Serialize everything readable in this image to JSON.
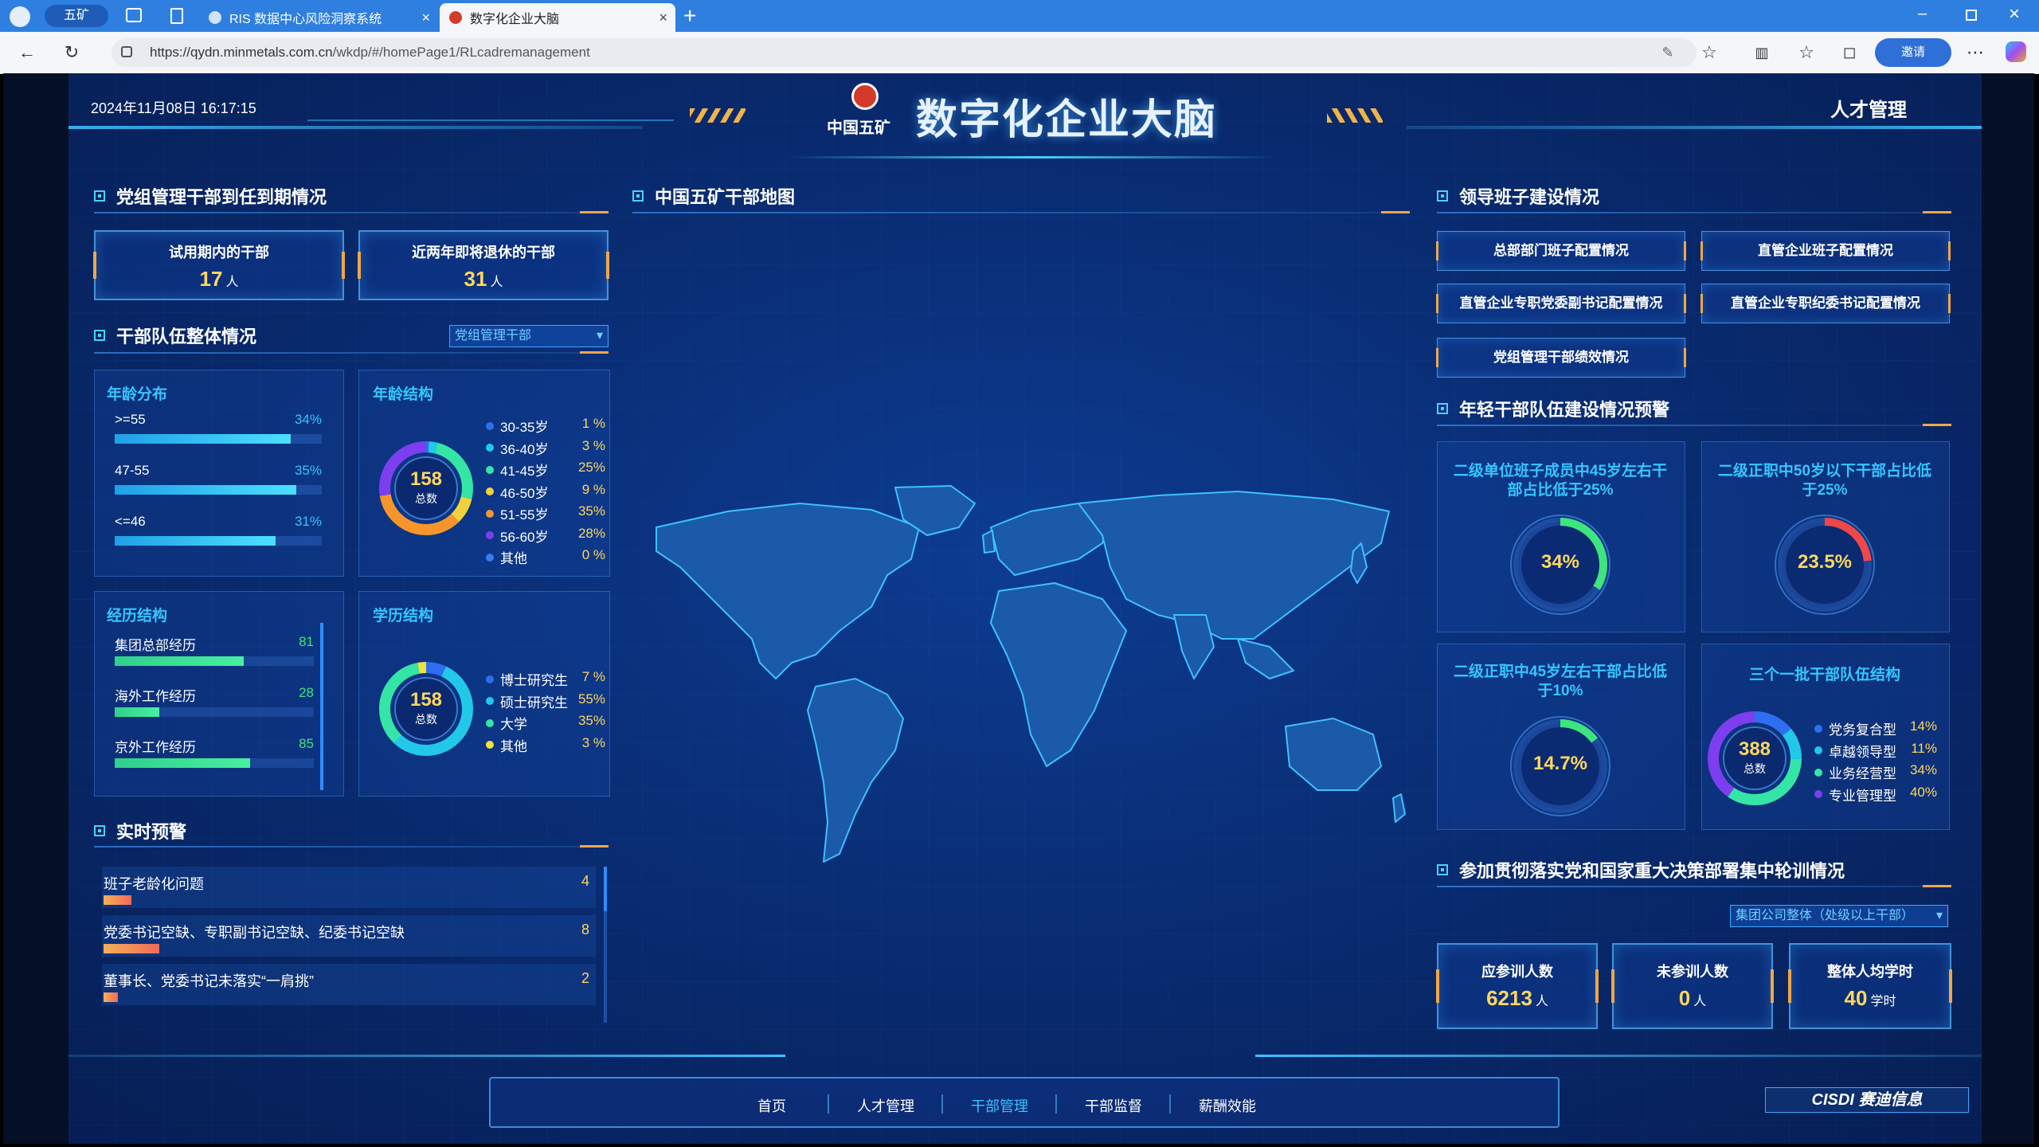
{
  "browser": {
    "profile_label": "五矿",
    "tabs": [
      {
        "title": "RIS 数据中心风险洞察系统"
      },
      {
        "title": "数字化企业大脑"
      }
    ],
    "url_host": "https://qydn.minmetals.com.cn",
    "url_path": "/wkdp/#/homePage1/RLcadremanagement",
    "invite_label": "邀请"
  },
  "header": {
    "datetime": "2024年11月08日 16:17:15",
    "logo_text": "中国五矿",
    "title": "数字化企业大脑",
    "section": "人才管理"
  },
  "left": {
    "term_title": "党组管理干部到任到期情况",
    "kpis": [
      {
        "label": "试用期内的干部",
        "value": "17",
        "unit": "人"
      },
      {
        "label": "近两年即将退休的干部",
        "value": "31",
        "unit": "人"
      }
    ],
    "team_title": "干部队伍整体情况",
    "team_select": "党组管理干部",
    "age_dist": {
      "title": "年龄分布",
      "rows": [
        {
          "label": ">=55",
          "pct": "34%",
          "value": 34
        },
        {
          "label": "47-55",
          "pct": "35%",
          "value": 35
        },
        {
          "label": "<=46",
          "pct": "31%",
          "value": 31
        }
      ]
    },
    "age_struct": {
      "title": "年龄结构",
      "total": "158",
      "total_label": "总数",
      "rows": [
        {
          "label": "30-35岁",
          "pct": "1 %",
          "value": 1,
          "color": "#2d6ff0"
        },
        {
          "label": "36-40岁",
          "pct": "3 %",
          "value": 3,
          "color": "#22c8e8"
        },
        {
          "label": "41-45岁",
          "pct": "25%",
          "value": 25,
          "color": "#34e5a6"
        },
        {
          "label": "46-50岁",
          "pct": "9 %",
          "value": 9,
          "color": "#f2d23c"
        },
        {
          "label": "51-55岁",
          "pct": "35%",
          "value": 35,
          "color": "#f5952c"
        },
        {
          "label": "56-60岁",
          "pct": "28%",
          "value": 28,
          "color": "#7d3ef0"
        },
        {
          "label": "其他",
          "pct": "0 %",
          "value": 0,
          "color": "#3a7bf0"
        }
      ]
    },
    "exp_struct": {
      "title": "经历结构",
      "rows": [
        {
          "label": "集团总部经历",
          "value": 81
        },
        {
          "label": "海外工作经历",
          "value": 28
        },
        {
          "label": "京外工作经历",
          "value": 85
        }
      ]
    },
    "edu_struct": {
      "title": "学历结构",
      "total": "158",
      "total_label": "总数",
      "rows": [
        {
          "label": "博士研究生",
          "pct": "7 %",
          "value": 7,
          "color": "#2d6ff0"
        },
        {
          "label": "硕士研究生",
          "pct": "55%",
          "value": 55,
          "color": "#22c8e8"
        },
        {
          "label": "大学",
          "pct": "35%",
          "value": 35,
          "color": "#34e5a6"
        },
        {
          "label": "其他",
          "pct": "3 %",
          "value": 3,
          "color": "#f2e23c"
        }
      ]
    },
    "alert_title": "实时预警",
    "alerts": [
      {
        "label": "班子老龄化问题",
        "count": "4",
        "value": 4
      },
      {
        "label": "党委书记空缺、专职副书记空缺、纪委书记空缺",
        "count": "8",
        "value": 8
      },
      {
        "label": "董事长、党委书记未落实“一肩挑”",
        "count": "2",
        "value": 2
      }
    ]
  },
  "center": {
    "map_title": "中国五矿干部地图"
  },
  "right": {
    "leadership_title": "领导班子建设情况",
    "buttons": [
      "总部部门班子配置情况",
      "直管企业班子配置情况",
      "直管企业专职党委副书记配置情况",
      "直管企业专职纪委书记配置情况",
      "党组管理干部绩效情况"
    ],
    "young_title": "年轻干部队伍建设情况预警",
    "gauges": [
      {
        "title": "二级单位班子成员中45岁左右干部占比低于25%",
        "label": "34%",
        "value": 34,
        "color": "#3de57d"
      },
      {
        "title": "二级正职中50岁以下干部占比低于25%",
        "label": "23.5%",
        "value": 23.5,
        "color": "#f04848"
      },
      {
        "title": "二级正职中45岁左右干部占比低于10%",
        "label": "14.7%",
        "value": 14.7,
        "color": "#3de57d"
      }
    ],
    "three_batch": {
      "title": "三个一批干部队伍结构",
      "total": "388",
      "total_label": "总数",
      "rows": [
        {
          "label": "党务复合型",
          "pct": "14%",
          "value": 14,
          "color": "#2d6ff0"
        },
        {
          "label": "卓越领导型",
          "pct": "11%",
          "value": 11,
          "color": "#22c8e8"
        },
        {
          "label": "业务经营型",
          "pct": "34%",
          "value": 34,
          "color": "#34e5a6"
        },
        {
          "label": "专业管理型",
          "pct": "40%",
          "value": 40,
          "color": "#7d3ef0"
        }
      ]
    },
    "training_title": "参加贯彻落实党和国家重大决策部署集中轮训情况",
    "training_select": "集团公司整体（处级以上干部）",
    "training_kpis": [
      {
        "label": "应参训人数",
        "value": "6213",
        "unit": "人"
      },
      {
        "label": "未参训人数",
        "value": "0",
        "unit": "人"
      },
      {
        "label": "整体人均学时",
        "value": "40",
        "unit": "学时"
      }
    ]
  },
  "footer": {
    "nav": [
      "首页",
      "人才管理",
      "干部管理",
      "干部监督",
      "薪酬效能"
    ],
    "active": "干部管理",
    "brand": "CISDI 赛迪信息"
  }
}
